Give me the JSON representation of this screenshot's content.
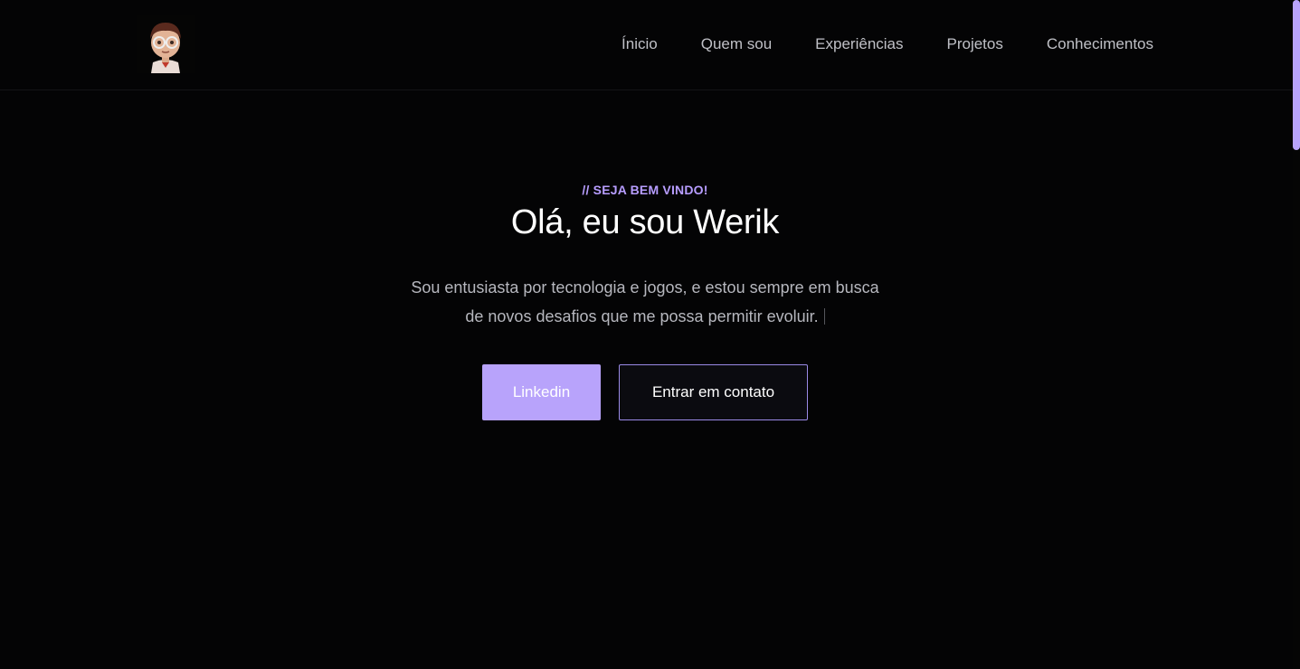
{
  "nav": {
    "items": [
      {
        "label": "Ínicio"
      },
      {
        "label": "Quem sou"
      },
      {
        "label": "Experiências"
      },
      {
        "label": "Projetos"
      },
      {
        "label": "Conhecimentos"
      }
    ]
  },
  "hero": {
    "eyebrow": "// SEJA BEM VINDO!",
    "title": "Olá, eu sou Werik",
    "subtitle": "Sou entusiasta por tecnologia e jogos, e estou sempre em busca de novos desafios que me possa permitir evoluir.",
    "buttons": {
      "primary_label": "Linkedin",
      "secondary_label": "Entrar em contato"
    }
  },
  "colors": {
    "accent": "#b8a3fb",
    "background": "#040405",
    "muted_text": "#b6b7be"
  },
  "icons": {
    "logo": "avatar-logo-icon"
  }
}
